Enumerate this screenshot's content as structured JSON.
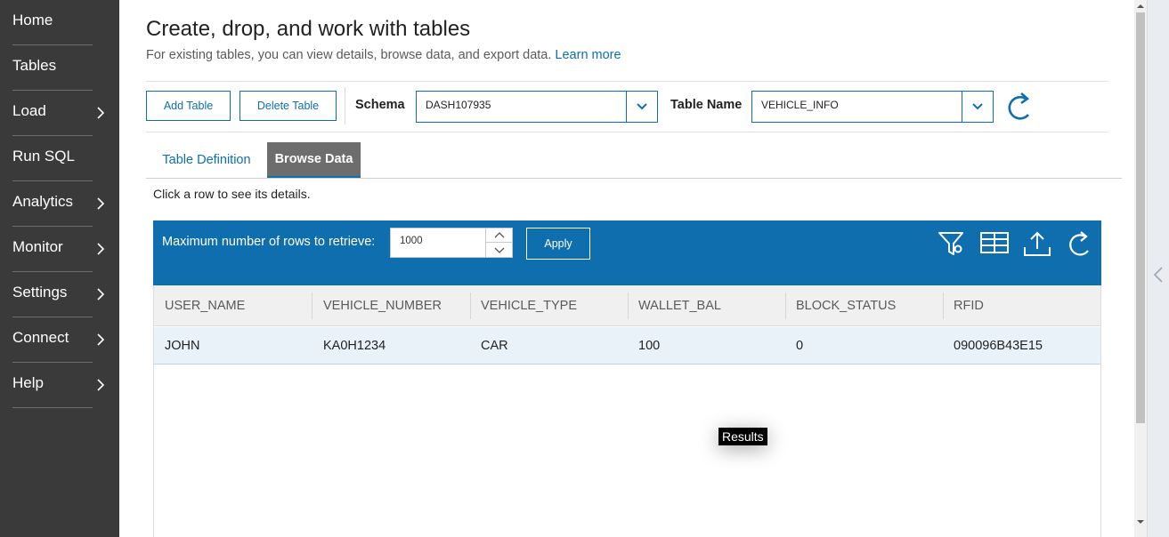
{
  "colors": {
    "sidebar": "#3a3a3a",
    "accent": "#0f6fae",
    "active_tab": "#6d6d6d"
  },
  "sidebar": {
    "items": [
      {
        "label": "Home",
        "has_submenu": false
      },
      {
        "label": "Tables",
        "has_submenu": false
      },
      {
        "label": "Load",
        "has_submenu": true
      },
      {
        "label": "Run SQL",
        "has_submenu": false
      },
      {
        "label": "Analytics",
        "has_submenu": true
      },
      {
        "label": "Monitor",
        "has_submenu": true
      },
      {
        "label": "Settings",
        "has_submenu": true
      },
      {
        "label": "Connect",
        "has_submenu": true
      },
      {
        "label": "Help",
        "has_submenu": true
      }
    ]
  },
  "header": {
    "title": "Create, drop, and work with tables",
    "subtitle": "For existing tables, you can view details, browse data, and export data.",
    "learn_more": "Learn more"
  },
  "toolbar": {
    "add_table": "Add Table",
    "delete_table": "Delete Table",
    "schema_label": "Schema",
    "schema_value": "DASH107935",
    "table_name_label": "Table Name",
    "table_name_value": "VEHICLE_INFO",
    "refresh_icon": "refresh-icon"
  },
  "tabs": [
    {
      "label": "Table Definition",
      "active": false
    },
    {
      "label": "Browse Data",
      "active": true
    }
  ],
  "hint": "Click a row to see its details.",
  "results_bar": {
    "max_rows_label": "Maximum number of rows to retrieve:",
    "max_rows_value": "1000",
    "apply": "Apply",
    "icons": [
      "filter-icon",
      "table-columns-icon",
      "export-icon",
      "refresh-icon"
    ]
  },
  "table": {
    "columns": [
      "USER_NAME",
      "VEHICLE_NUMBER",
      "VEHICLE_TYPE",
      "WALLET_BAL",
      "BLOCK_STATUS",
      "RFID"
    ],
    "rows": [
      [
        "JOHN",
        "KA0H1234",
        "CAR",
        "100",
        "0",
        "090096B43E15"
      ]
    ]
  },
  "tooltip": "Results"
}
